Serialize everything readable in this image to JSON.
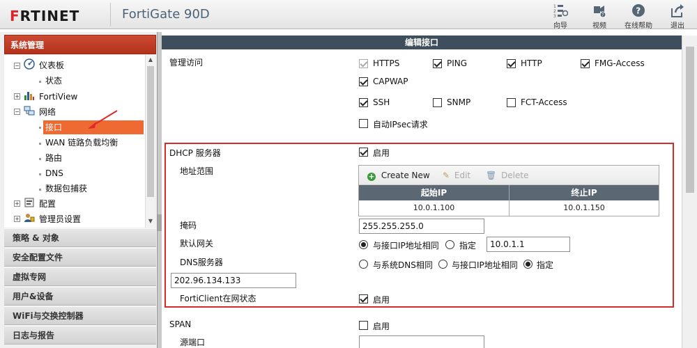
{
  "header": {
    "logo_prefix": "F",
    "logo_rest": "RTINET",
    "model": "FortiGate 90D",
    "actions": [
      {
        "label": "向导",
        "icon": "wizard-icon"
      },
      {
        "label": "视频",
        "icon": "video-icon"
      },
      {
        "label": "在线帮助",
        "icon": "help-icon"
      },
      {
        "label": "退出",
        "icon": "logout-icon"
      }
    ]
  },
  "sidebar": {
    "title": "系统管理",
    "tree": [
      {
        "label": "仪表板",
        "icon": "dashboard-icon",
        "expander": "-"
      },
      {
        "label": "状态"
      },
      {
        "label": "FortiView",
        "icon": "bar-chart-icon",
        "expander": "+"
      },
      {
        "label": "网络",
        "icon": "network-icon",
        "expander": "-"
      },
      {
        "label": "接口",
        "active": true
      },
      {
        "label": "WAN 链路负载均衡"
      },
      {
        "label": "路由"
      },
      {
        "label": "DNS"
      },
      {
        "label": "数据包捕获"
      },
      {
        "label": "配置",
        "icon": "config-icon",
        "expander": "+"
      },
      {
        "label": "管理员设置",
        "icon": "admin-icon",
        "expander": "+"
      }
    ],
    "sections": [
      "策略 & 对象",
      "安全配置文件",
      "虚拟专网",
      "用户&设备",
      "WiFi与交换控制器",
      "日志与报告"
    ]
  },
  "panel": {
    "title": "编辑接口",
    "admin_access": {
      "label": "管理访问",
      "options": [
        {
          "label": "HTTPS",
          "checked": true,
          "disabled": true
        },
        {
          "label": "PING",
          "checked": true
        },
        {
          "label": "HTTP",
          "checked": true
        },
        {
          "label": "FMG-Access",
          "checked": true
        },
        {
          "label": "CAPWAP",
          "checked": true
        },
        {
          "label": "SSH",
          "checked": true
        },
        {
          "label": "SNMP",
          "checked": false
        },
        {
          "label": "FCT-Access",
          "checked": false
        },
        {
          "label": "自动IPsec请求",
          "checked": false
        }
      ]
    },
    "dhcp": {
      "label": "DHCP 服务器",
      "enable_label": "启用",
      "enabled": true,
      "address_range_label": "地址范围",
      "toolbar": {
        "create": "Create New",
        "edit": "Edit",
        "delete": "Delete"
      },
      "columns": [
        "起始IP",
        "终止IP"
      ],
      "rows": [
        {
          "start": "10.0.1.100",
          "end": "10.0.1.150"
        }
      ],
      "netmask_label": "掩码",
      "netmask": "255.255.255.0",
      "gateway_label": "默认网关",
      "gateway_opt_same": "与接口IP地址相同",
      "gateway_opt_specify": "指定",
      "gateway_value": "10.0.1.1",
      "dns_label": "DNS服务器",
      "dns_opt_system": "与系统DNS相同",
      "dns_opt_iface": "与接口IP地址相同",
      "dns_opt_specify": "指定",
      "dns_value": "202.96.134.133",
      "forticlient_label": "FortiClient在网状态",
      "forticlient_enable_label": "启用"
    },
    "span": {
      "label": "SPAN",
      "enable_label": "启用",
      "source_port_label": "源端口"
    }
  }
}
